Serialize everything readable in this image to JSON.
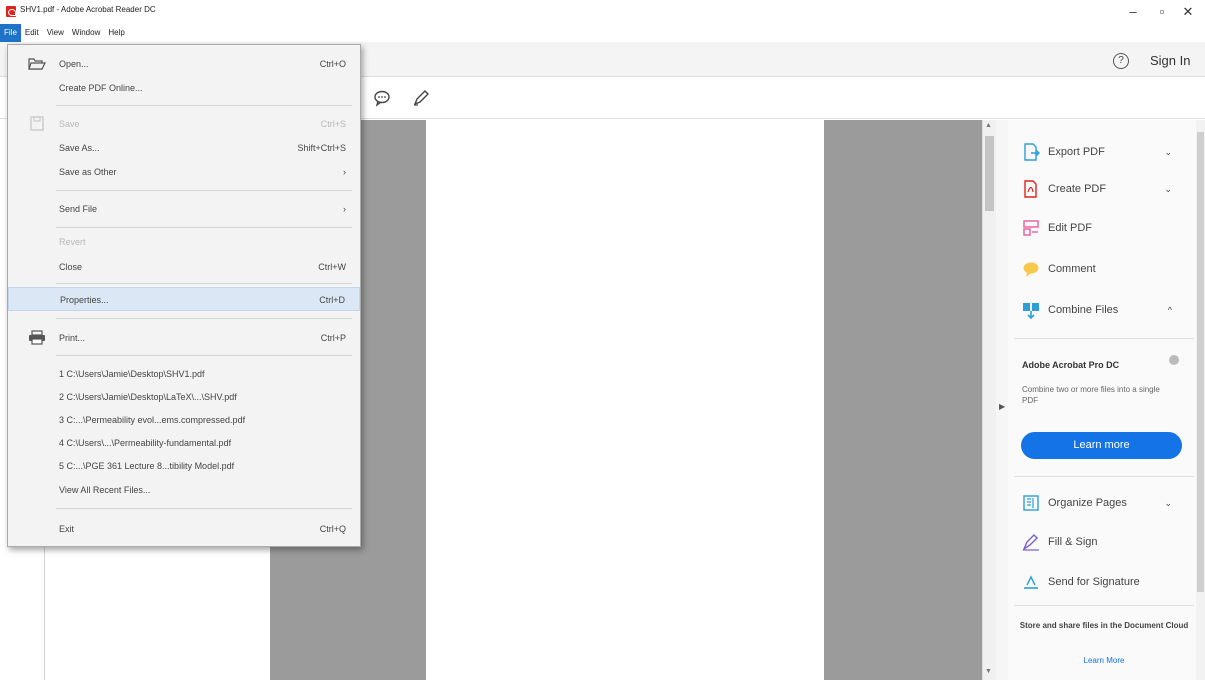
{
  "window": {
    "title": "SHV1.pdf - Adobe Acrobat Reader DC",
    "minimize": "–",
    "maximize": "▫",
    "close": "✕"
  },
  "menubar": [
    "File",
    "Edit",
    "View",
    "Window",
    "Help"
  ],
  "toolbar": {
    "help": "?",
    "signin": "Sign In"
  },
  "file_menu": {
    "items": [
      {
        "label": "Open...",
        "shortcut": "Ctrl+O",
        "icon": "folder-open-icon"
      },
      {
        "label": "Create PDF Online...",
        "shortcut": ""
      },
      {
        "label": "Save",
        "shortcut": "Ctrl+S",
        "disabled": true,
        "icon": "save-icon"
      },
      {
        "label": "Save As...",
        "shortcut": "Shift+Ctrl+S"
      },
      {
        "label": "Save as Other",
        "shortcut": "›"
      },
      {
        "label": "Send File",
        "shortcut": "›"
      },
      {
        "label": "Revert",
        "shortcut": "",
        "disabled": true
      },
      {
        "label": "Close",
        "shortcut": "Ctrl+W"
      },
      {
        "label": "Properties...",
        "shortcut": "Ctrl+D"
      },
      {
        "label": "Print...",
        "shortcut": "Ctrl+P",
        "icon": "printer-icon"
      },
      {
        "label": "1 C:\\Users\\Jamie\\Desktop\\SHV1.pdf",
        "shortcut": ""
      },
      {
        "label": "2 C:\\Users\\Jamie\\Desktop\\LaTeX\\...\\SHV.pdf",
        "shortcut": ""
      },
      {
        "label": "3 C:...\\Permeability evol...ems.compressed.pdf",
        "shortcut": ""
      },
      {
        "label": "4 C:\\Users\\...\\Permeability-fundamental.pdf",
        "shortcut": ""
      },
      {
        "label": "5 C:...\\PGE 361 Lecture 8...tibility Model.pdf",
        "shortcut": ""
      },
      {
        "label": "View All Recent Files...",
        "shortcut": ""
      },
      {
        "label": "Exit",
        "shortcut": "Ctrl+Q"
      }
    ]
  },
  "right_panel": {
    "tools": [
      {
        "label": "Export PDF",
        "chevron": "⌄"
      },
      {
        "label": "Create PDF",
        "chevron": "⌄"
      },
      {
        "label": "Edit PDF",
        "chevron": ""
      },
      {
        "label": "Comment",
        "chevron": ""
      },
      {
        "label": "Combine Files",
        "chevron": "^"
      }
    ],
    "promo": {
      "title": "Adobe Acrobat Pro DC",
      "text": "Combine two or more files into a single PDF",
      "button": "Learn more"
    },
    "tools2": [
      {
        "label": "Organize Pages",
        "chevron": "⌄"
      },
      {
        "label": "Fill & Sign",
        "chevron": ""
      },
      {
        "label": "Send for Signature",
        "chevron": ""
      }
    ],
    "cloud_text": "Store and share files in the Document Cloud",
    "cloud_link": "Learn More"
  },
  "colors": {
    "accent": "#1473e6",
    "menu_active": "#1e72c8",
    "doc_bg": "#9b9b9b"
  }
}
